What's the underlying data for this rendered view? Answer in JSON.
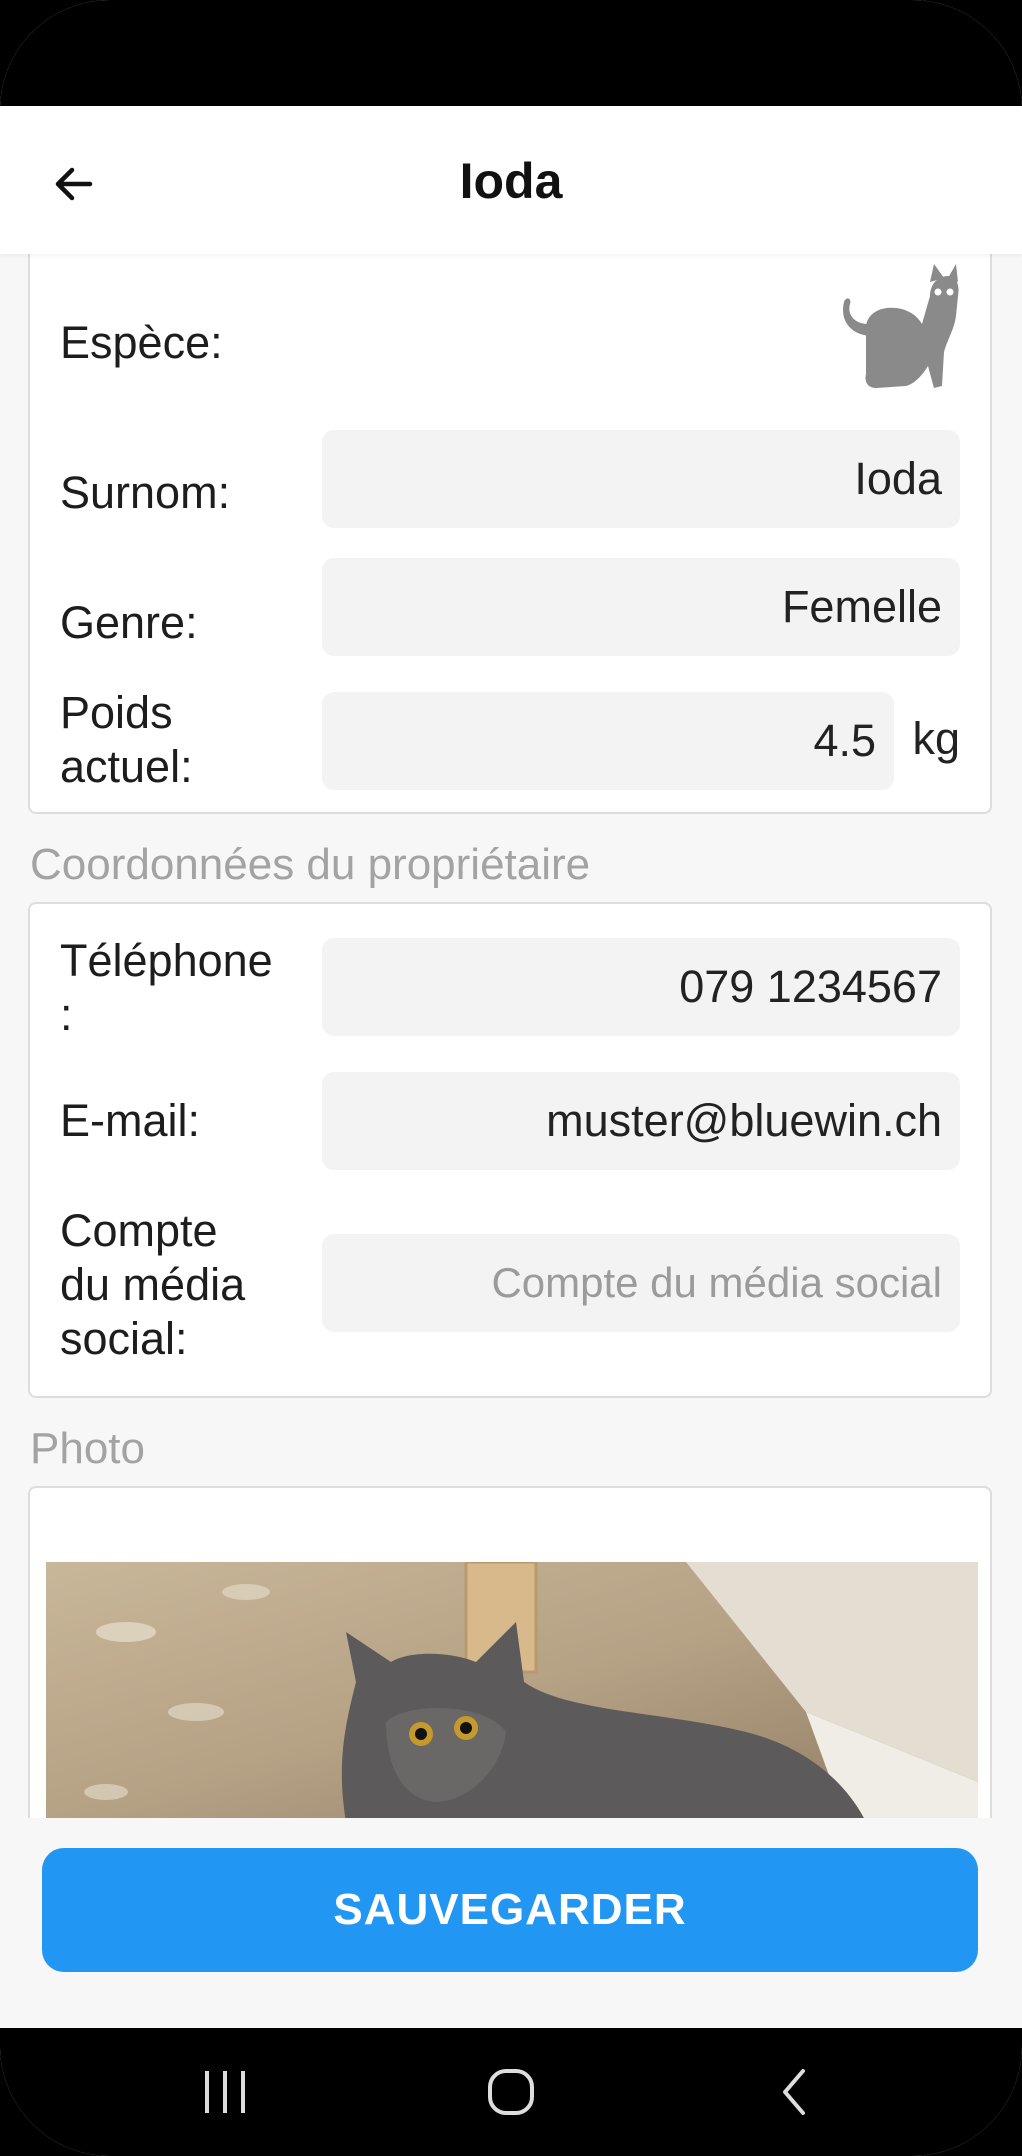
{
  "app_bar": {
    "title": "Ioda",
    "back_icon": "arrow-left-icon"
  },
  "animal": {
    "species_label": "Espèce:",
    "species_icon": "cat-icon",
    "nickname_label": "Surnom:",
    "nickname_value": "Ioda",
    "gender_label": "Genre:",
    "gender_value": "Femelle",
    "weight_label_1": "Poids",
    "weight_label_2": "actuel:",
    "weight_value": "4.5",
    "weight_unit": "kg"
  },
  "owner": {
    "section_title": "Coordonnées du propriétaire",
    "phone_label_1": "Téléphone",
    "phone_label_2": ":",
    "phone_value": "079 1234567",
    "email_label": "E-mail:",
    "email_value": "muster@bluewin.ch",
    "social_label_1": "Compte",
    "social_label_2": "du média",
    "social_label_3": "social:",
    "social_placeholder": "Compte du média social"
  },
  "photo": {
    "section_title": "Photo"
  },
  "actions": {
    "save_label": "SAUVEGARDER"
  },
  "nav": {
    "recents_icon": "recents-icon",
    "home_icon": "home-icon",
    "back_icon": "back-chevron-icon"
  },
  "colors": {
    "accent": "#2196f3",
    "card_border": "#dddddd",
    "field_bg": "#f3f3f3",
    "section_title": "#a3a3a3"
  }
}
